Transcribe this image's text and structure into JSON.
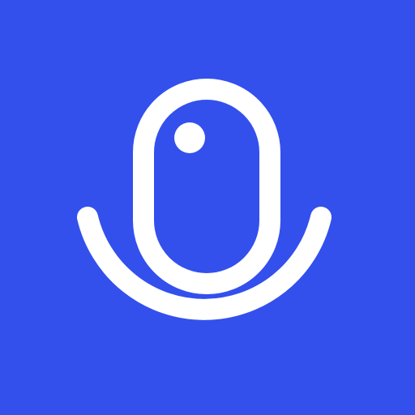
{
  "icon": {
    "name": "microphone-icon",
    "background_color": "#3350ED",
    "foreground_color": "#FFFFFF"
  }
}
